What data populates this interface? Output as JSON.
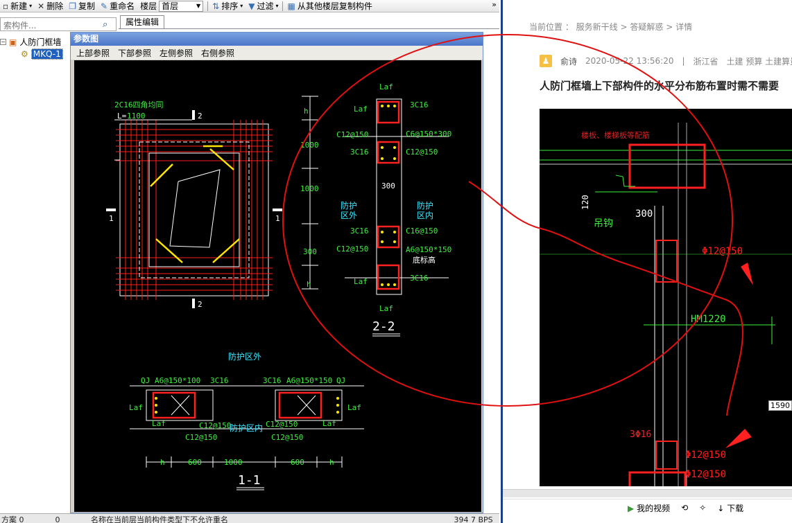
{
  "toolbar": {
    "new": "新建",
    "delete": "删除",
    "copy": "复制",
    "rename": "重命名",
    "floor_label": "楼层",
    "floor_value": "首层",
    "sort": "排序",
    "filter": "过滤",
    "copy_from_other": "从其他楼层复制构件",
    "overflow": "»"
  },
  "left_panel": {
    "search_placeholder": "索构件...",
    "tree": {
      "root": "人防门框墙",
      "child": "MKQ-1"
    }
  },
  "tabs": {
    "properties": "属性编辑"
  },
  "dialog": {
    "title": "参数图",
    "tabs": [
      "上部参照",
      "下部参照",
      "左侧参照",
      "右侧参照"
    ]
  },
  "drawing": {
    "plan": {
      "note1": "2C16四角均同",
      "note2_prefix": "L=",
      "note2_value": "1100",
      "sec2_top": "2",
      "sec2_bottom": "2",
      "sec1_left": "1",
      "sec1_right": "1"
    },
    "section22": {
      "title": "2-2",
      "labels": [
        "Laf",
        "Laf",
        "3C16",
        "C12@150",
        "C6@150*300",
        "3C16",
        "C12@150",
        "300",
        "防护",
        "区外",
        "防护",
        "区内",
        "3C16",
        "C16@150",
        "C12@150",
        "A6@150*150",
        "底标高",
        "Laf",
        "3C16",
        "Laf"
      ],
      "dims": [
        "h",
        "1000",
        "1000",
        "300",
        "h"
      ]
    },
    "section11": {
      "title": "1-1",
      "top_label": "防护区外",
      "inner_label": "防护区内",
      "labels": [
        "QJ",
        "A6@150*100",
        "3C16",
        "3C16",
        "A6@150*150",
        "QJ",
        "Laf",
        "Laf",
        "Laf",
        "Laf",
        "C12@150",
        "C12@150",
        "C12@150",
        "C12@150"
      ],
      "dims": [
        "h",
        "600",
        "1000",
        "600",
        "h"
      ]
    }
  },
  "status": {
    "left": "方案  0",
    "mid": "0",
    "message": "名称在当前层当前构件类型下不允许重名",
    "right": "394  7  BPS"
  },
  "right": {
    "breadcrumb": [
      "当前位置",
      "服务新干线",
      "答疑解惑",
      "详情"
    ],
    "author": "俞诗",
    "date": "2020-05-22 13:56:20",
    "location": "浙江省",
    "tags": "土建  预算  土建算量",
    "title": "人防门框墙上下部构件的水平分布筋布置时需不需要",
    "image_labels": [
      "吊钩",
      "300",
      "120",
      "Φ12@150",
      "HM1220",
      "3Φ16",
      "Φ12@150",
      "Φ12@150",
      "楼板、楼梯板等配筋"
    ],
    "side_number": "1590",
    "video_bar": [
      "我的视频",
      "下载"
    ]
  },
  "colors": {
    "accent": "#1b3f87",
    "cad_red": "#ff2020",
    "cad_yellow": "#ffe600",
    "cad_green": "#3cf23c",
    "cad_cyan": "#3ce6ff",
    "annotation_red": "#e01010"
  }
}
